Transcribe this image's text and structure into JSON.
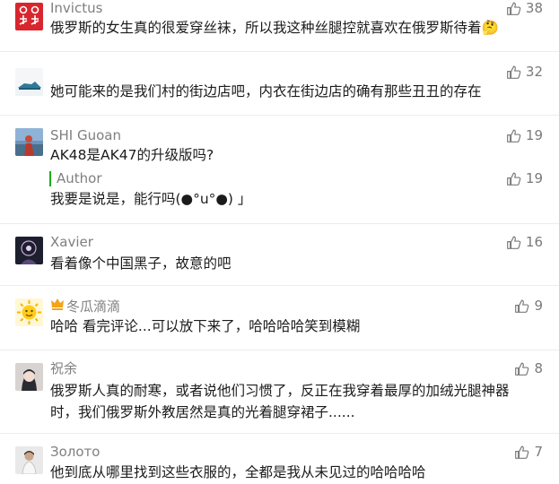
{
  "comments": [
    {
      "name": "Invictus",
      "likes": "38",
      "text": "俄罗斯的女生真的很爱穿丝袜，所以我这种丝腿控就喜欢在俄罗斯待着🤔"
    },
    {
      "name": "",
      "likes": "32",
      "text": "她可能来的是我们村的街边店吧，内衣在街边店的确有那些丑丑的存在"
    },
    {
      "name": "SHI Guoan",
      "likes": "19",
      "text": "AK48是AK47的升级版吗?",
      "reply": {
        "label": "Author",
        "likes": "19",
        "text": "我要是说是，能行吗(●°u°●) 」"
      }
    },
    {
      "name": "Xavier",
      "likes": "16",
      "text": "看着像个中国黑子，故意的吧"
    },
    {
      "name": "冬瓜滴滴",
      "likes": "9",
      "text": "哈哈 看完评论...可以放下来了，哈哈哈哈笑到模糊"
    },
    {
      "name": "祝余",
      "likes": "8",
      "text": "俄罗斯人真的耐寒，或者说他们习惯了，反正在我穿着最厚的加绒光腿神器",
      "text2": "时，我们俄罗斯外教居然是真的光着腿穿裙子......"
    },
    {
      "name": "Золото",
      "likes": "7",
      "text": "他到底从哪里找到这些衣服的，全都是我从未见过的哈哈哈哈"
    }
  ],
  "colors": {
    "text": "#1b1b1b",
    "meta": "#7f7f7f",
    "author_bar": "#1aad19",
    "separator": "#ececec"
  },
  "icons": {
    "like": "thumbs-up-icon",
    "name_badge": "crown-icon"
  }
}
